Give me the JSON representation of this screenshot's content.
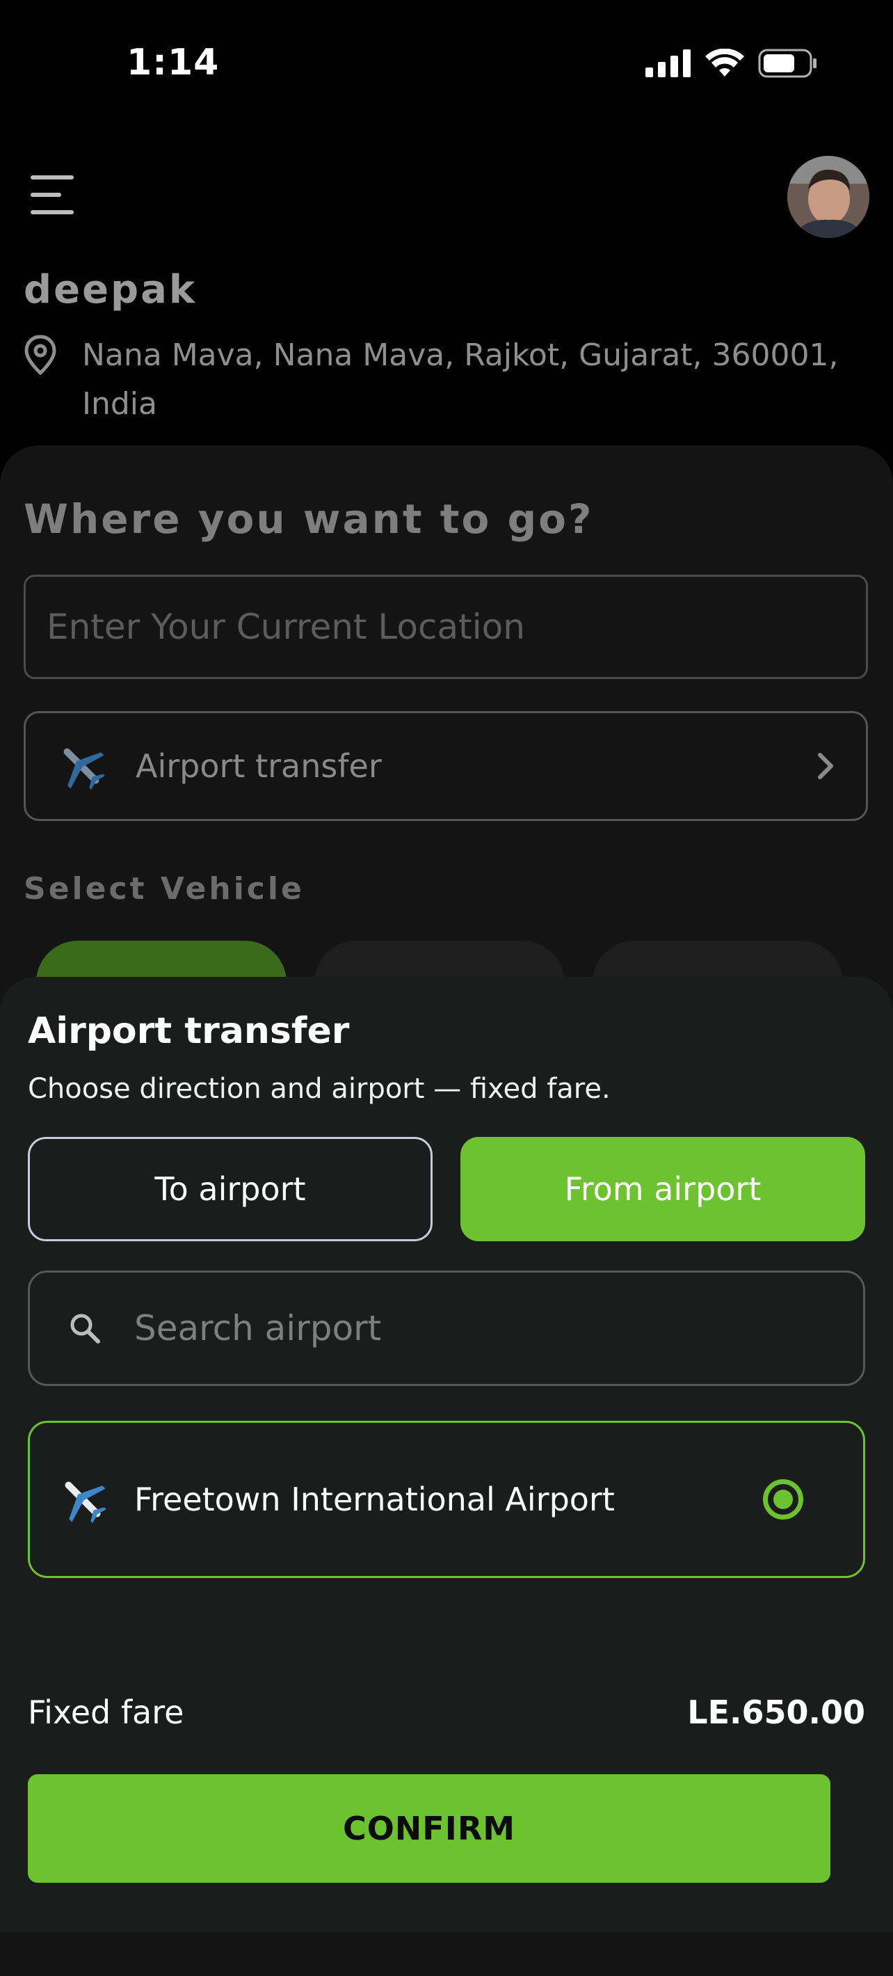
{
  "status_bar": {
    "time": "1:14"
  },
  "header": {
    "user_name": "deepak",
    "address": "Nana Mava, Nana Mava, Rajkot, Gujarat, 360001, India"
  },
  "main": {
    "heading": "Where you want to go?",
    "location_placeholder": "Enter Your Current Location",
    "airport_transfer_label": "Airport transfer",
    "select_vehicle_label": "Select Vehicle"
  },
  "sheet": {
    "title": "Airport transfer",
    "subtitle": "Choose direction and airport — fixed fare.",
    "to_airport_label": "To airport",
    "from_airport_label": "From airport",
    "selected_direction": "From airport",
    "search_placeholder": "Search airport",
    "airports": [
      {
        "name": "Freetown International Airport",
        "selected": true
      }
    ],
    "fare_label": "Fixed fare",
    "fare_value": "LE.650.00",
    "confirm_label": "CONFIRM"
  },
  "colors": {
    "accent": "#6cc22f",
    "background": "#000000",
    "sheet": "#1b1c1c"
  },
  "icons": [
    "signal-icon",
    "wifi-icon",
    "battery-icon",
    "menu-icon",
    "location-pin-icon",
    "airplane-icon",
    "chevron-right-icon",
    "search-icon",
    "radio-selected-icon"
  ]
}
